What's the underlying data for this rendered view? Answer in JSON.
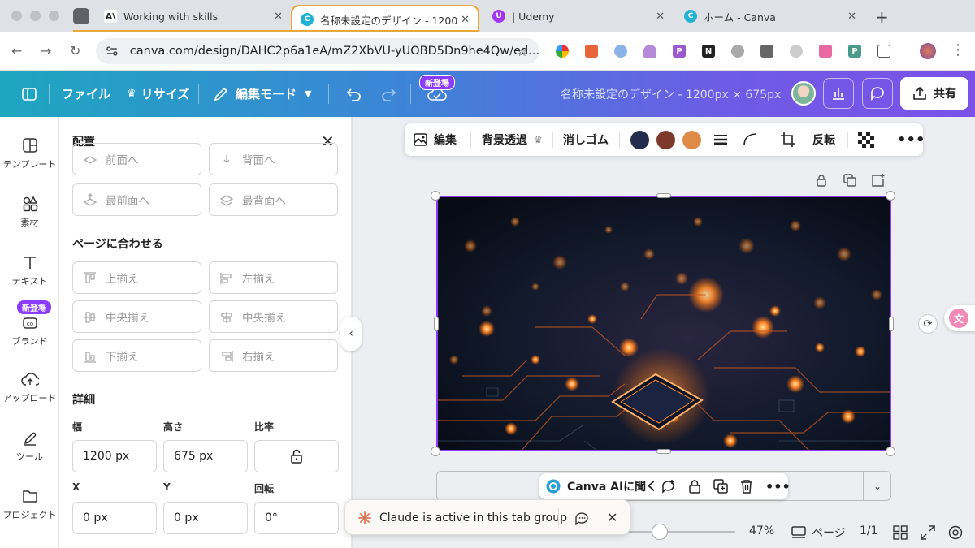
{
  "browser": {
    "tabs": [
      {
        "title": "Working with skills",
        "favicon": "anthropic-icon"
      },
      {
        "title": "名称未設定のデザイン - 1200",
        "favicon": "canva-icon",
        "active": true
      },
      {
        "title": "| Udemy",
        "favicon": "udemy-icon"
      },
      {
        "title": "ホーム - Canva",
        "favicon": "canva-icon"
      }
    ],
    "url": "canva.com/design/DAHC2p6a1eA/mZ2XbVU-yUOBD5Dn9he4Qw/ed..."
  },
  "header": {
    "file_label": "ファイル",
    "resize_label": "リサイズ",
    "edit_mode_label": "編集モード",
    "new_badge": "新登場",
    "doc_title": "名称未設定のデザイン - 1200px × 675px",
    "share_label": "共有"
  },
  "rail": {
    "items": [
      {
        "label": "テンプレート",
        "icon": "template-icon"
      },
      {
        "label": "素材",
        "icon": "elements-icon"
      },
      {
        "label": "テキスト",
        "icon": "text-icon"
      },
      {
        "label": "ブランド",
        "icon": "brand-icon",
        "badge": "新登場"
      },
      {
        "label": "アップロード",
        "icon": "upload-icon"
      },
      {
        "label": "ツール",
        "icon": "tools-icon"
      },
      {
        "label": "プロジェクト",
        "icon": "folder-icon"
      }
    ]
  },
  "panel": {
    "title": "配置",
    "layer_buttons": {
      "forward": "前面へ",
      "backward": "背面へ",
      "front": "最前面へ",
      "back": "最背面へ"
    },
    "fit_section_title": "ページに合わせる",
    "align": {
      "top": "上揃え",
      "left": "左揃え",
      "middle": "中央揃え",
      "center": "中央揃え",
      "bottom": "下揃え",
      "right": "右揃え"
    },
    "detail_title": "詳細",
    "width_label": "幅",
    "height_label": "高さ",
    "ratio_label": "比率",
    "width_value": "1200 px",
    "height_value": "675 px",
    "x_label": "X",
    "y_label": "Y",
    "rotate_label": "回転",
    "x_value": "0 px",
    "y_value": "0 px",
    "rotate_value": "0°"
  },
  "context_toolbar": {
    "edit_label": "編集",
    "bg_remove_label": "背景透過",
    "eraser_label": "消しゴム",
    "flip_label": "反転",
    "colors": [
      "#252d4e",
      "#7d3a2c",
      "#e08a48"
    ]
  },
  "ai_bar": {
    "label": "Canva AIに聞く"
  },
  "footer": {
    "zoom": "47%",
    "pages_label": "ページ",
    "page_count": "1/1"
  },
  "claude_toast": {
    "text": "Claude is active in this tab group"
  }
}
